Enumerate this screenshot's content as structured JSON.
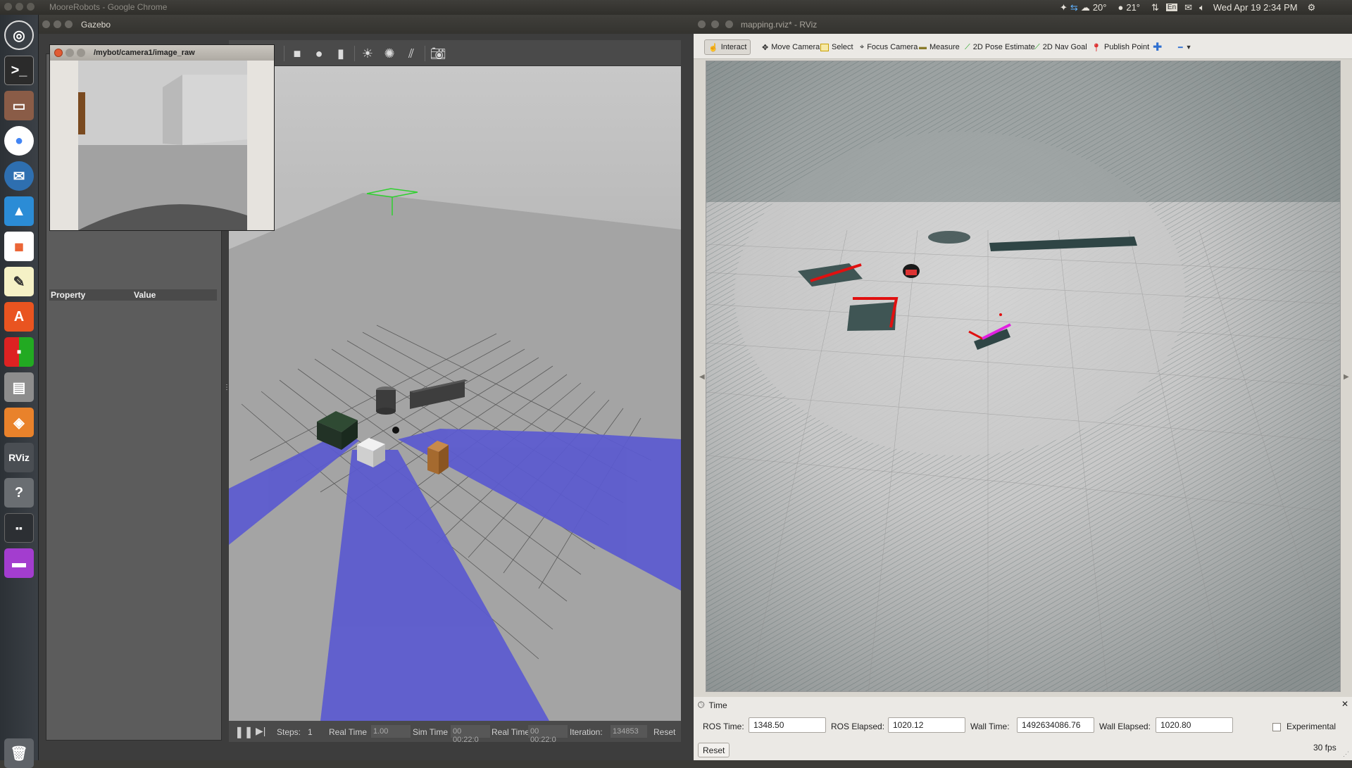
{
  "top_panel": {
    "app_title": "MooreRobots - Google Chrome",
    "weather1": "20°",
    "weather2": "21°",
    "keyboard": "En",
    "clock": "Wed Apr 19  2:34 PM"
  },
  "launcher": {
    "items": [
      "dash",
      "terminal",
      "files",
      "chrome",
      "thunderbird",
      "education",
      "apps",
      "text-editor",
      "software-center",
      "libreoffice",
      "printer",
      "gazebo",
      "rviz",
      "help",
      "workspace",
      "purple-app",
      "trash"
    ],
    "rviz_label": "RViz"
  },
  "gazebo": {
    "window_title": "Gazebo",
    "camera_window_title": "/mybot/camera1/image_raw",
    "property_header": "Property",
    "value_header": "Value",
    "bottom": {
      "steps_label": "Steps:",
      "steps_value": "1",
      "real_time_factor_label": "Real Time",
      "real_time_factor_value": "1.00",
      "sim_time_label": "Sim Time",
      "sim_time_value": "00 00:22:0",
      "real_time_label": "Real Time",
      "real_time_value": "00 00:22:0",
      "iterations_label": "Iteration:",
      "iterations_value": "134853",
      "reset_label": "Reset"
    }
  },
  "rviz": {
    "window_title": "mapping.rviz* - RViz",
    "toolbar": {
      "interact": "Interact",
      "move_camera": "Move Camera",
      "select": "Select",
      "focus_camera": "Focus Camera",
      "measure": "Measure",
      "pose_estimate": "2D Pose Estimate",
      "nav_goal": "2D Nav Goal",
      "publish_point": "Publish Point"
    },
    "time_panel": {
      "title": "Time",
      "ros_time_label": "ROS Time:",
      "ros_time_value": "1348.50",
      "ros_elapsed_label": "ROS Elapsed:",
      "ros_elapsed_value": "1020.12",
      "wall_time_label": "Wall Time:",
      "wall_time_value": "1492634086.76",
      "wall_elapsed_label": "Wall Elapsed:",
      "wall_elapsed_value": "1020.80",
      "experimental_label": "Experimental",
      "reset_label": "Reset",
      "fps": "30 fps"
    }
  },
  "colors": {
    "laser_blue": "#5b5ad0",
    "laser_red": "#e01010",
    "laser_magenta": "#e020e0",
    "map_dark": "#2f4545"
  }
}
